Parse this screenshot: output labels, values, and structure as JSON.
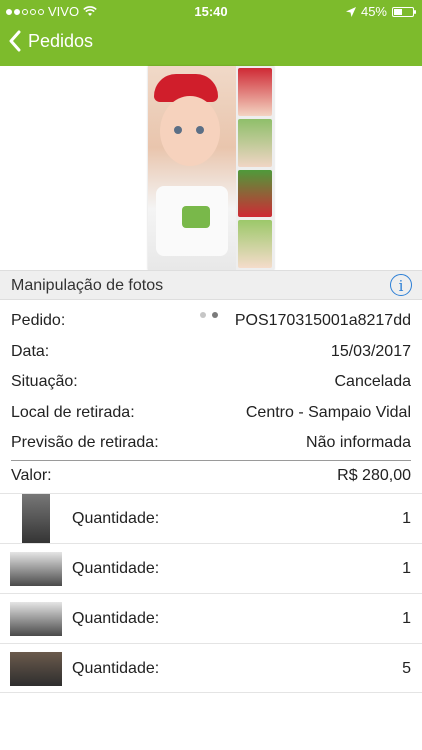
{
  "status": {
    "carrier": "VIVO",
    "time": "15:40",
    "battery": "45%",
    "battery_level": 0.45,
    "signal_bars_filled": 2,
    "signal_bars_total": 5
  },
  "nav": {
    "back_label": "Pedidos"
  },
  "gallery": {
    "pages": 2,
    "active_page": 1
  },
  "section": {
    "title": "Manipulação de fotos",
    "info_icon": "info-icon"
  },
  "details": [
    {
      "label": "Pedido:",
      "value": "POS170315001a8217dd"
    },
    {
      "label": "Data:",
      "value": "15/03/2017"
    },
    {
      "label": "Situação:",
      "value": "Cancelada"
    },
    {
      "label": "Local de retirada:",
      "value": "Centro - Sampaio Vidal"
    },
    {
      "label": "Previsão de retirada:",
      "value": "Não informada"
    }
  ],
  "valor": {
    "label": "Valor:",
    "value": "R$ 280,00"
  },
  "items": [
    {
      "label": "Quantidade:",
      "qty": "1"
    },
    {
      "label": "Quantidade:",
      "qty": "1"
    },
    {
      "label": "Quantidade:",
      "qty": "1"
    },
    {
      "label": "Quantidade:",
      "qty": "5"
    }
  ],
  "colors": {
    "accent": "#7dbb2c",
    "info": "#2c7fd6"
  }
}
